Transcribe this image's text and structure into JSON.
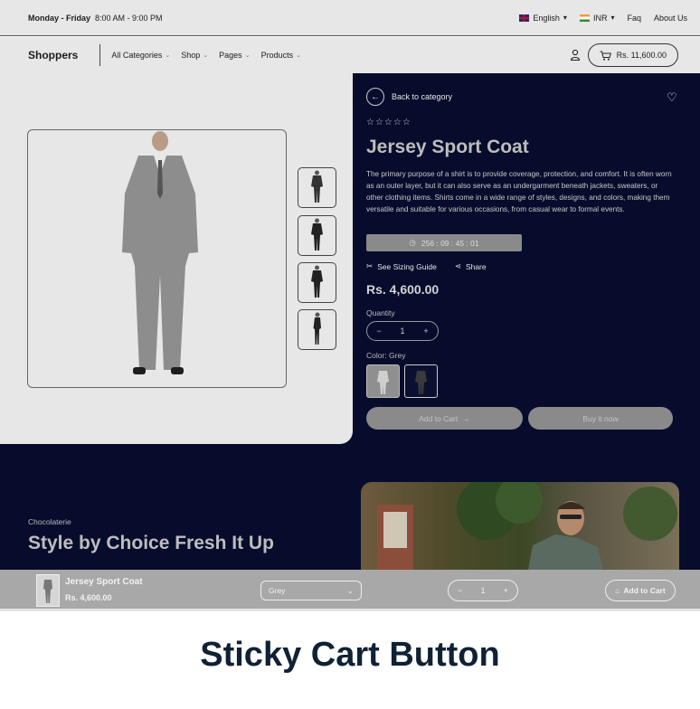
{
  "topbar": {
    "days": "Monday - Friday",
    "time": "8:00 AM - 9:00 PM",
    "language": "English",
    "currency": "INR",
    "faq": "Faq",
    "about": "About Us"
  },
  "nav": {
    "brand": "Shoppers",
    "items": [
      "All Categories",
      "Shop",
      "Pages",
      "Products"
    ],
    "cart_total": "Rs. 11,600.00"
  },
  "product": {
    "back": "Back to category",
    "stars": "☆☆☆☆☆",
    "title": "Jersey Sport Coat",
    "description": "The primary purpose of a shirt is to provide coverage, protection, and comfort. It is often worn as an outer layer, but it can also serve as an undergarment beneath jackets, sweaters, or other clothing items. Shirts come in a wide range of styles, designs, and colors, making them versatile and suitable for various occasions, from casual wear to formal events.",
    "timer": "256 : 09 : 45 : 01",
    "sizing": "See Sizing Guide",
    "share": "Share",
    "price": "Rs. 4,600.00",
    "quantity_label": "Quantity",
    "quantity": "1",
    "color_label": "Color: Grey",
    "add_to_cart": "Add to Cart",
    "buy_now": "Buy it now"
  },
  "promo": {
    "subtitle": "Chocolaterie",
    "title": "Style by Choice Fresh It Up"
  },
  "sticky": {
    "name": "Jersey Sport Coat",
    "price": "Rs. 4,600.00",
    "color": "Grey",
    "quantity": "1",
    "add_to_cart": "Add to Cart"
  },
  "caption": "Sticky Cart Button"
}
